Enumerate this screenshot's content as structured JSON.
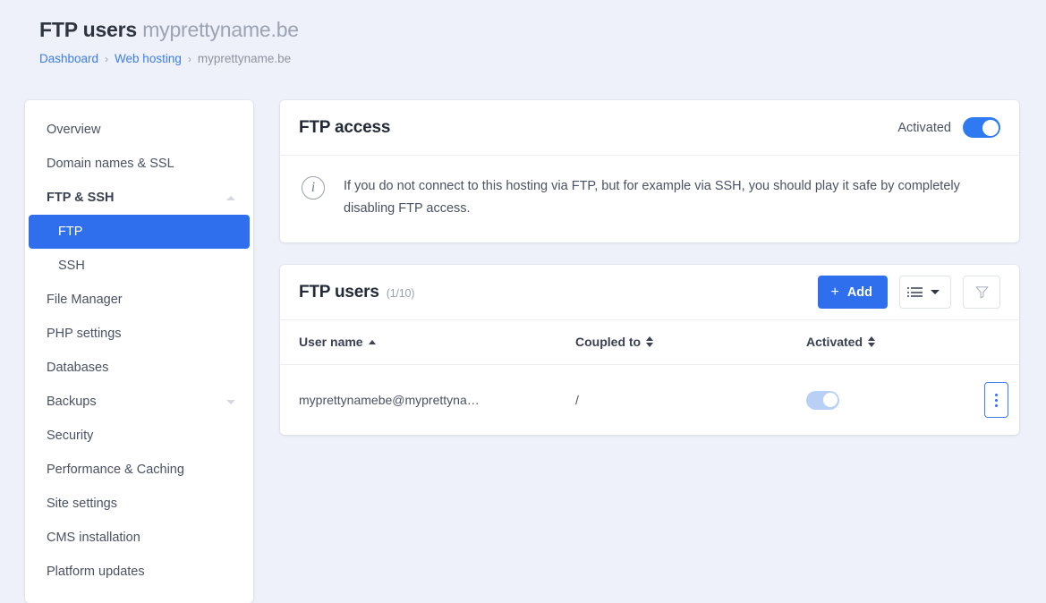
{
  "header": {
    "title_strong": "FTP users",
    "title_light": "myprettyname.be",
    "breadcrumb": {
      "dashboard": "Dashboard",
      "web_hosting": "Web hosting",
      "current": "myprettyname.be",
      "separator": "›"
    }
  },
  "sidebar": {
    "items": [
      {
        "label": "Overview"
      },
      {
        "label": "Domain names & SSL"
      },
      {
        "label": "FTP & SSH"
      },
      {
        "label": "FTP"
      },
      {
        "label": "SSH"
      },
      {
        "label": "File Manager"
      },
      {
        "label": "PHP settings"
      },
      {
        "label": "Databases"
      },
      {
        "label": "Backups"
      },
      {
        "label": "Security"
      },
      {
        "label": "Performance & Caching"
      },
      {
        "label": "Site settings"
      },
      {
        "label": "CMS installation"
      },
      {
        "label": "Platform updates"
      }
    ]
  },
  "ftp_access": {
    "title": "FTP access",
    "toggle_label": "Activated",
    "toggle_state": "on",
    "notice": "If you do not connect to this hosting via FTP, but for example via SSH, you should play it safe by completely disabling FTP access."
  },
  "ftp_users": {
    "title": "FTP users",
    "count": "(1/10)",
    "add_label": "Add",
    "add_plus": "+",
    "columns": {
      "user_name": "User name",
      "coupled_to": "Coupled to",
      "activated": "Activated"
    },
    "rows": [
      {
        "user_name": "myprettynamebe@myprettyna…",
        "coupled_to": "/",
        "activated": "off"
      }
    ]
  },
  "colors": {
    "accent": "#2f6fed",
    "page_bg": "#eef1f9",
    "link": "#3d7dec",
    "toggle_off": "#b9d0f6"
  }
}
